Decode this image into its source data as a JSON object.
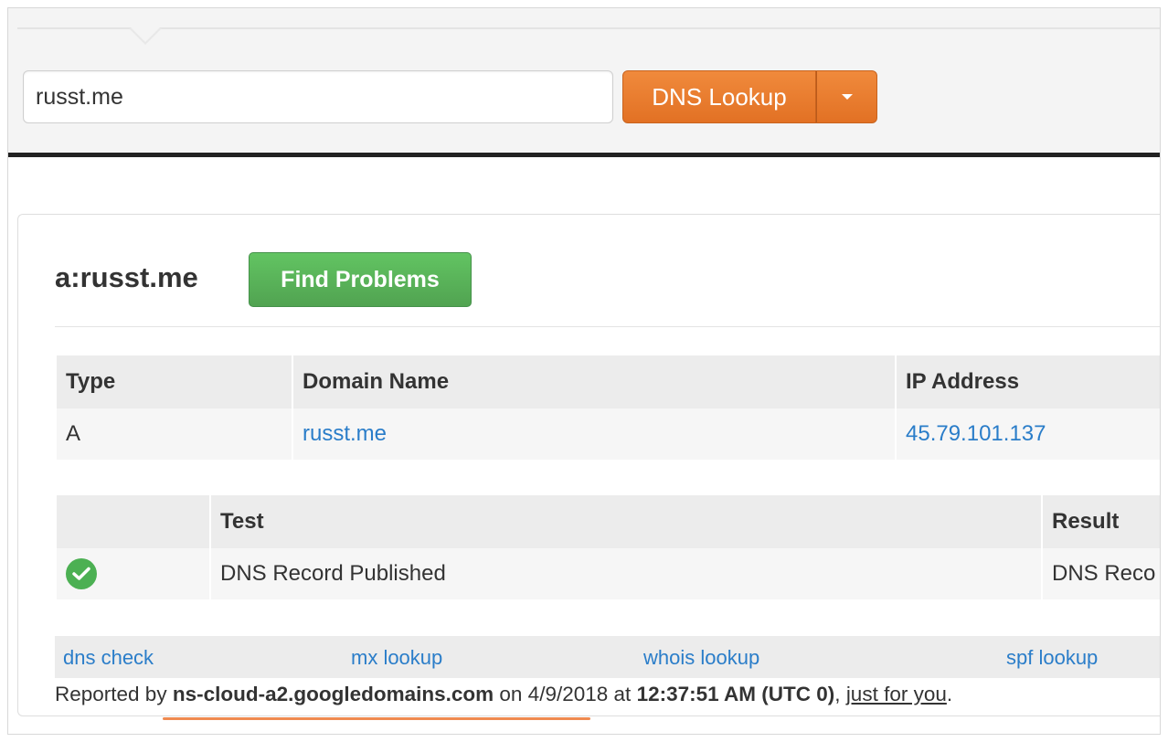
{
  "search": {
    "value": "russt.me"
  },
  "lookup_button": {
    "label": "DNS Lookup"
  },
  "result": {
    "title": "a:russt.me",
    "find_problems_label": "Find Problems"
  },
  "records_table": {
    "headers": [
      "Type",
      "Domain Name",
      "IP Address"
    ],
    "rows": [
      {
        "type": "A",
        "domain": "russt.me",
        "ip": "45.79.101.137"
      }
    ]
  },
  "tests_table": {
    "headers": [
      "",
      "Test",
      "Result"
    ],
    "rows": [
      {
        "status": "check-icon",
        "test": "DNS Record Published",
        "result": "DNS Reco"
      }
    ]
  },
  "links": [
    "dns check",
    "mx lookup",
    "whois lookup",
    "spf lookup"
  ],
  "footer": {
    "prefix": "Reported by",
    "server": "ns-cloud-a2.googledomains.com",
    "on": "on 4/9/2018 at",
    "time": "12:37:51 AM (UTC 0)",
    "comma": ",",
    "just_for_you": "just for you",
    "period": "."
  },
  "colors": {
    "accent_orange": "#e27124",
    "success_green": "#51a351",
    "link_blue": "#2a7dc9"
  }
}
